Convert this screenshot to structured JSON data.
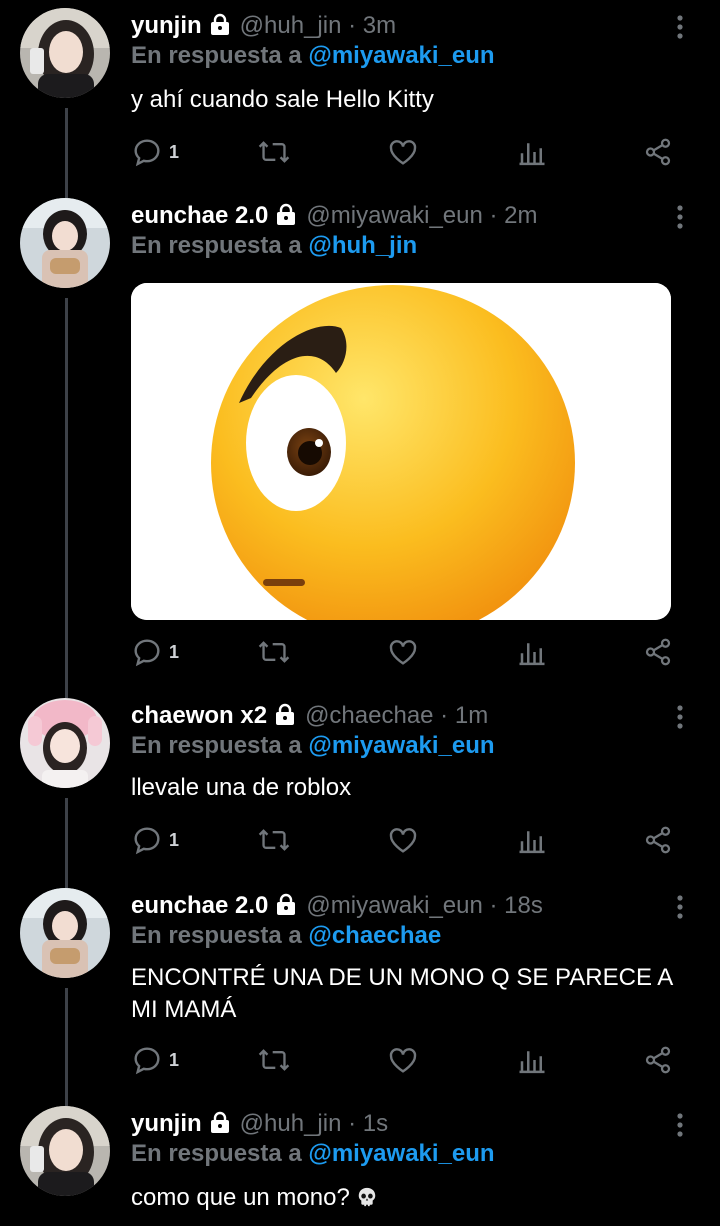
{
  "reply_prefix": "En respuesta a",
  "tweets": [
    {
      "name": "yunjin",
      "handle_time": "@huh_jin · 3m",
      "reply_to": "@miyawaki_eun",
      "text": "y ahí cuando sale Hello Kitty",
      "reply_count": "1"
    },
    {
      "name": "eunchae 2.0",
      "handle_time": "@miyawaki_eun · 2m",
      "reply_to": "@huh_jin",
      "text": "",
      "reply_count": "1",
      "media": "emoji-image"
    },
    {
      "name": "chaewon x2",
      "handle_time": "@chaechae · 1m",
      "reply_to": "@miyawaki_eun",
      "text": "llevale una de roblox",
      "reply_count": "1"
    },
    {
      "name": "eunchae 2.0",
      "handle_time": "@miyawaki_eun · 18s",
      "reply_to": "@chaechae",
      "text": "ENCONTRÉ UNA DE UN MONO Q SE PARECE A MI MAMÁ",
      "reply_count": "1"
    },
    {
      "name": "yunjin",
      "handle_time": "@huh_jin · 1s",
      "reply_to": "@miyawaki_eun",
      "text": "como que un mono?",
      "text_emoji": "skull-emoji",
      "reply_count": ""
    }
  ],
  "colors": {
    "background": "#000000",
    "secondary_text": "#71767b",
    "accent": "#1d9bf0",
    "thread_line": "#3d4148"
  },
  "icons": [
    "lock-icon",
    "more-icon",
    "reply-icon",
    "retweet-icon",
    "like-icon",
    "views-icon",
    "share-icon"
  ]
}
